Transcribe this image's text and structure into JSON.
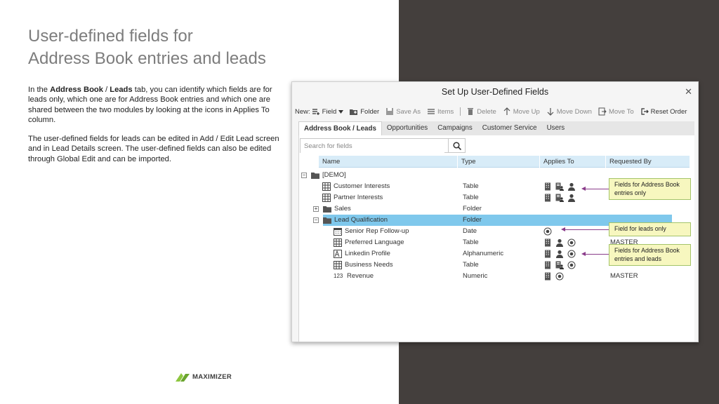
{
  "slide": {
    "title_line1": "User-defined fields for",
    "title_line2": "Address Book entries and leads",
    "para1": {
      "pre": "In the ",
      "bold1": "Address Book",
      "mid": " / ",
      "bold2": "Leads",
      "post": " tab, you can identify which fields are for leads only, which one are for Address Book entries and which one are shared between the two modules by looking at the icons in Applies To column."
    },
    "para2": "The user-defined fields for leads can be edited in Add / Edit Lead screen and in Lead Details screen. The user-defined fields can also be edited through Global Edit and can be imported.",
    "logo_text": "MAXIMIZER"
  },
  "dialog": {
    "title": "Set Up User-Defined Fields",
    "close": "✕",
    "toolbar": {
      "new_label": "New:",
      "field": "Field",
      "folder": "Folder",
      "save_as": "Save As",
      "items": "Items",
      "delete": "Delete",
      "move_up": "Move Up",
      "move_down": "Move Down",
      "move_to": "Move To",
      "reset_order": "Reset Order"
    },
    "tabs": [
      "Address Book / Leads",
      "Opportunities",
      "Campaigns",
      "Customer Service",
      "Users"
    ],
    "search_placeholder": "Search for fields",
    "columns": [
      "Name",
      "Type",
      "Applies To",
      "Requested By"
    ],
    "rows": [
      {
        "name": "[DEMO]",
        "type": "",
        "requested": "",
        "toggle": "−",
        "icon": "folder-icon",
        "applies": []
      },
      {
        "name": "Customer Interests",
        "type": "Table",
        "requested": "",
        "icon": "table-icon",
        "applies": [
          "company-icon",
          "contact-icon",
          "person-icon"
        ]
      },
      {
        "name": "Partner Interests",
        "type": "Table",
        "requested": "",
        "icon": "table-icon",
        "applies": [
          "company-icon",
          "contact-icon",
          "person-icon"
        ]
      },
      {
        "name": "Sales",
        "type": "Folder",
        "requested": "",
        "toggle": "+",
        "icon": "folder-icon",
        "applies": []
      },
      {
        "name": "Lead Qualification",
        "type": "Folder",
        "requested": "",
        "toggle": "−",
        "icon": "folder-icon",
        "applies": [],
        "selected": true
      },
      {
        "name": "Senior Rep Follow-up",
        "type": "Date",
        "requested": "",
        "icon": "calendar-icon",
        "applies": [
          "lead-icon"
        ]
      },
      {
        "name": "Preferred Language",
        "type": "Table",
        "requested": "MASTER",
        "icon": "table-icon",
        "applies": [
          "company-icon",
          "person-icon",
          "lead-icon"
        ]
      },
      {
        "name": "Linkedin Profile",
        "type": "Alphanumeric",
        "requested": "",
        "icon": "alphanumeric-icon",
        "applies": [
          "company-icon",
          "person-icon",
          "lead-icon"
        ]
      },
      {
        "name": "Business Needs",
        "type": "Table",
        "requested": "",
        "icon": "table-icon",
        "applies": [
          "company-icon",
          "contact-icon",
          "lead-icon"
        ]
      },
      {
        "name": "Revenue",
        "type": "Numeric",
        "requested": "MASTER",
        "icon": "numeric-icon",
        "icon_text": "123",
        "applies": [
          "company-icon",
          "lead-icon"
        ]
      }
    ]
  },
  "callouts": {
    "ab_only": "Fields for Address Book entries only",
    "leads_only": "Field for leads only",
    "both": "Fields for Address Book entries and leads"
  },
  "colors": {
    "dark_panel": "#443f3d",
    "title_gray": "#7d7d7d",
    "header_blue": "#d8ecf8",
    "selected_blue": "#7fc8ec",
    "callout_bg": "#f7f7bf",
    "arrow": "#8a3c8a",
    "logo_green": "#8dc63f"
  }
}
